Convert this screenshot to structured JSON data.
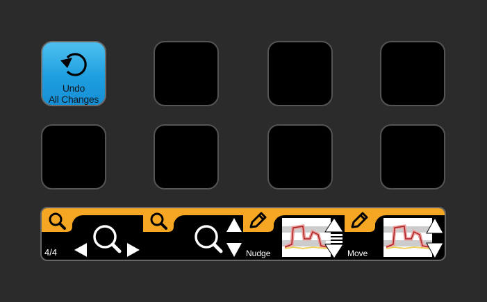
{
  "keys": {
    "undo": {
      "line1": "Undo",
      "line2": "All Changes",
      "icon": "undo-arrow-icon",
      "color": "#1e9fe0"
    },
    "empty_count": 7
  },
  "touch_strip": {
    "page_indicator": "4/4",
    "nudge_label": "Nudge",
    "move_label": "Move",
    "accent_color": "#f5a623"
  }
}
